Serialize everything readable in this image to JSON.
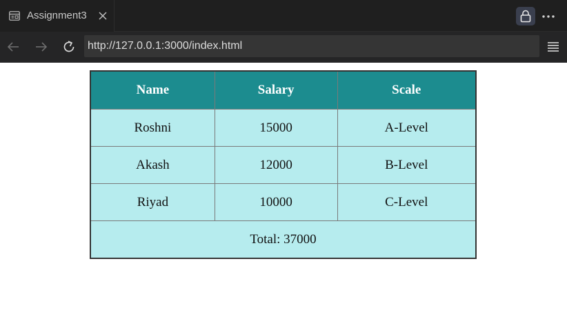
{
  "tab": {
    "title": "Assignment3",
    "icon": "page-layout-icon",
    "close_icon": "close-icon"
  },
  "toolbar": {
    "lock_icon": "lock-icon",
    "more_icon": "more-icon",
    "back_icon": "arrow-left-icon",
    "forward_icon": "arrow-right-icon",
    "reload_icon": "reload-icon",
    "menu_icon": "menu-icon"
  },
  "address": {
    "url": "http://127.0.0.1:3000/index.html"
  },
  "table": {
    "headers": [
      "Name",
      "Salary",
      "Scale"
    ],
    "rows": [
      [
        "Roshni",
        "15000",
        "A-Level"
      ],
      [
        "Akash",
        "12000",
        "B-Level"
      ],
      [
        "Riyad",
        "10000",
        "C-Level"
      ]
    ],
    "footer": "Total: 37000"
  },
  "colors": {
    "header_bg": "#1c8c8f",
    "cell_bg": "#b6ecee",
    "chrome_bg": "#1f1f1f"
  }
}
